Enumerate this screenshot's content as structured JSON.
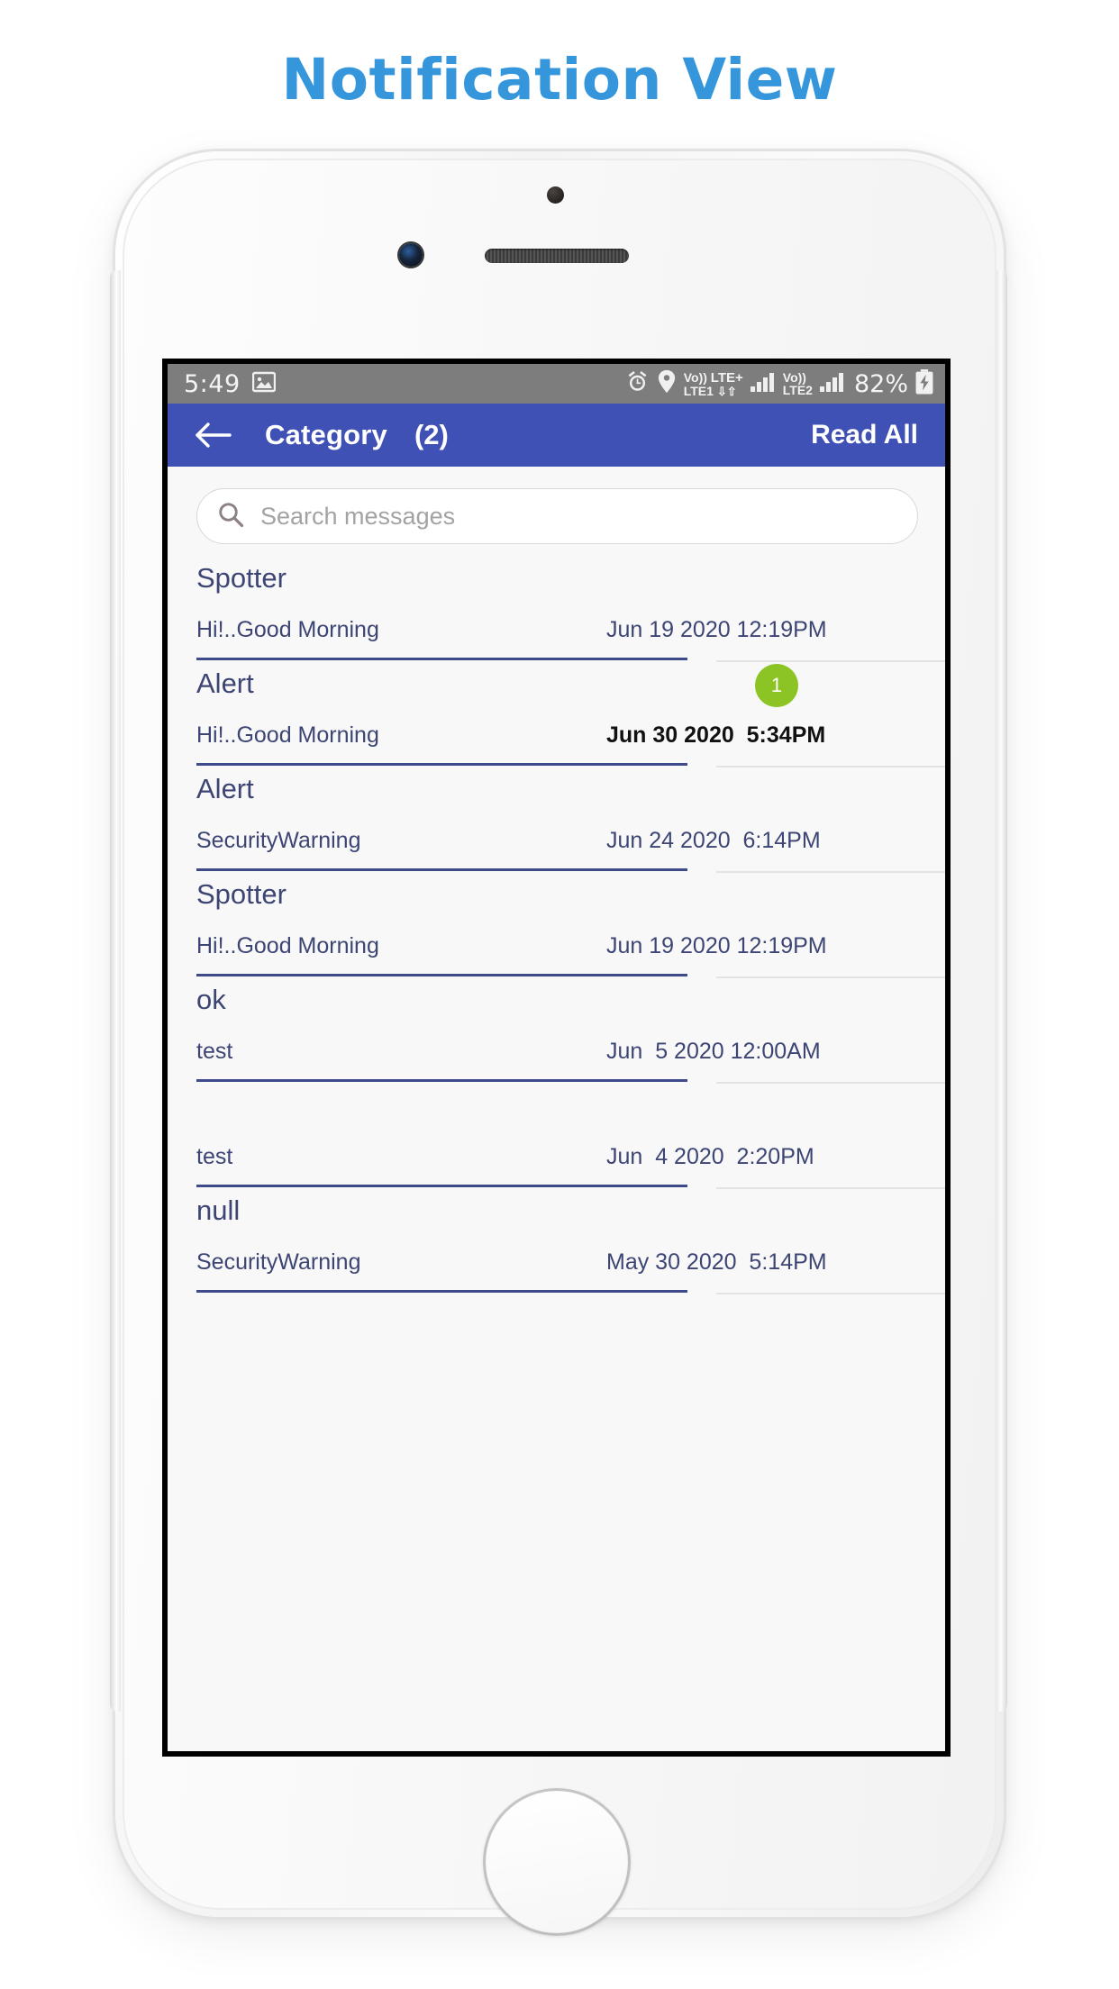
{
  "page": {
    "title": "Notification View",
    "title_color": "#3596dc"
  },
  "status_bar": {
    "time": "5:49",
    "left_icons": [
      "image-icon"
    ],
    "right_icons": [
      "alarm-icon",
      "location-pin-icon",
      "volte-signal-1",
      "signal-bars-1",
      "volte-signal-2",
      "signal-bars-2"
    ],
    "sim1_label_top": "Vo))",
    "sim1_label_bottom": "LTE1",
    "lte_plus_label": "LTE+",
    "sim2_label_top": "Vo))",
    "sim2_label_bottom": "LTE2",
    "battery_percent": "82%",
    "battery_state": "charging",
    "background_color": "#7d7d7d"
  },
  "app_bar": {
    "back_icon": "back-arrow-icon",
    "title": "Category",
    "count": "(2)",
    "read_all_label": "Read All",
    "background_color": "#3f51b5"
  },
  "search": {
    "icon": "search-icon",
    "placeholder": "Search messages",
    "value": ""
  },
  "messages": [
    {
      "title": "Spotter",
      "subtitle": "Hi!..Good Morning",
      "date": "Jun 19 2020 12:19PM",
      "unread": false,
      "badge": ""
    },
    {
      "title": "Alert",
      "subtitle": "Hi!..Good Morning",
      "date": "Jun 30 2020  5:34PM",
      "unread": true,
      "badge": "1"
    },
    {
      "title": "Alert",
      "subtitle": "SecurityWarning",
      "date": "Jun 24 2020  6:14PM",
      "unread": false,
      "badge": ""
    },
    {
      "title": "Spotter",
      "subtitle": "Hi!..Good Morning",
      "date": "Jun 19 2020 12:19PM",
      "unread": false,
      "badge": ""
    },
    {
      "title": "ok",
      "subtitle": "test",
      "date": "Jun  5 2020 12:00AM",
      "unread": false,
      "badge": ""
    },
    {
      "title": "",
      "subtitle": "test",
      "date": "Jun  4 2020  2:20PM",
      "unread": false,
      "badge": ""
    },
    {
      "title": "null",
      "subtitle": "SecurityWarning",
      "date": "May 30 2020  5:14PM",
      "unread": false,
      "badge": ""
    }
  ],
  "colors": {
    "accent_blue": "#3f51b5",
    "badge_green": "#8cc425",
    "divider_blue": "#3f4a8a",
    "text_navy": "#3d4574"
  }
}
